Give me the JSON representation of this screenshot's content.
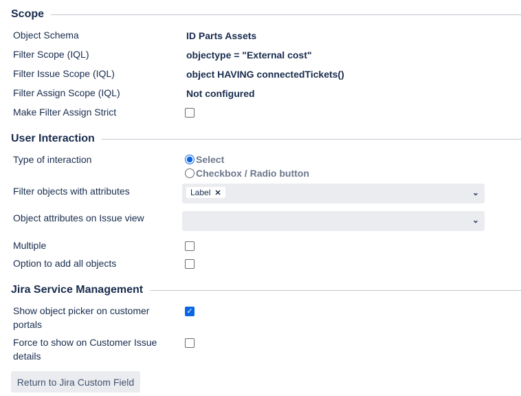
{
  "scope": {
    "title": "Scope",
    "rows": [
      {
        "label": "Object Schema",
        "value": "ID Parts Assets"
      },
      {
        "label": "Filter Scope (IQL)",
        "value": "objectype = \"External cost\""
      },
      {
        "label": "Filter Issue Scope (IQL)",
        "value": "object HAVING connectedTickets()"
      },
      {
        "label": "Filter Assign Scope (IQL)",
        "value": "Not configured"
      },
      {
        "label": "Make Filter Assign Strict",
        "checked": false
      }
    ]
  },
  "interaction": {
    "title": "User Interaction",
    "type_label": "Type of interaction",
    "options": [
      {
        "label": "Select",
        "selected": true
      },
      {
        "label": "Checkbox / Radio button",
        "selected": false
      }
    ],
    "filter_label": "Filter objects with attributes",
    "filter_tags": [
      "Label"
    ],
    "attrs_label": "Object attributes on Issue view",
    "multiple_label": "Multiple",
    "multiple": false,
    "addall_label": "Option to add all objects",
    "addall": false
  },
  "jsm": {
    "title": "Jira Service Management",
    "picker_label": "Show object picker on customer portals",
    "picker": true,
    "force_label": "Force to show on Customer Issue details",
    "force": false
  },
  "return_button": "Return to Jira Custom Field"
}
